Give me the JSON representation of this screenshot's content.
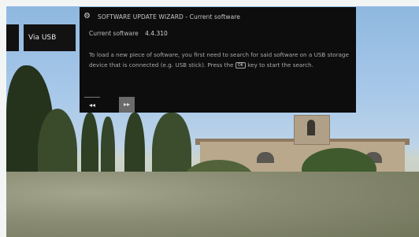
{
  "menu": {
    "selected_label": "Via USB"
  },
  "dialog": {
    "icon": "gear-icon",
    "title": "SOFTWARE UPDATE WIZARD - Current software",
    "current_software_label": "Current software",
    "current_software_value": "4.4.310",
    "body_part1": "To load a new piece of software, you first need to search for said software on a USB storage device that is connected (e.g. USB stick). Press the",
    "key_label": "OK",
    "body_part2": "key to start the search.",
    "prev_glyph": "◂◂",
    "next_glyph": "▸▸"
  }
}
